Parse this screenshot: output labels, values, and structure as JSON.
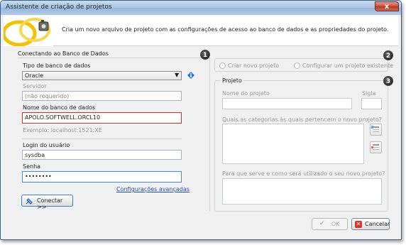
{
  "window": {
    "title": "Assistente de criação de projetos",
    "close_label": "x"
  },
  "banner": {
    "text": "Cria um novo arquivo de projeto com as configurações de acesso ao banco de dados e as propriedades do projeto."
  },
  "connection": {
    "section_title": "Conectando ao Banco de Dados",
    "step": "1",
    "db_type_label": "Tipo de banco de dados",
    "db_type_value": "Oracle",
    "server_label": "Servidor",
    "server_value": "(não requerido)",
    "db_name_label": "Nome do banco de dados",
    "db_name_value": "APOLO.SOFTWELL.ORCL10",
    "example_text": "Exemplo:  localhost:1521:XE",
    "login_label": "Login do usuário",
    "login_value": "sysdba",
    "password_label": "Senha",
    "password_value": "••••••••",
    "advanced_link": "Configurações avançadas",
    "connect_button": "Conectar >>"
  },
  "project_mode": {
    "step": "2",
    "new_project": "Criar novo projeto",
    "existing_project": "Configurar um projeto existente"
  },
  "project": {
    "step": "3",
    "group_title": "Projeto",
    "name_label": "Nome do projeto",
    "acronym_label": "Sigla",
    "categories_label": "Quais as categorias às quais pertencem o novo projeto?",
    "purpose_label": "Para que serve e como será utilizado o seu novo projeto?"
  },
  "footer": {
    "ok_button": "OK",
    "cancel_button": "Cancelar"
  },
  "colors": {
    "link": "#1f4fb8",
    "error_border": "#d22c2c",
    "focus_border": "#3d8ee6"
  }
}
